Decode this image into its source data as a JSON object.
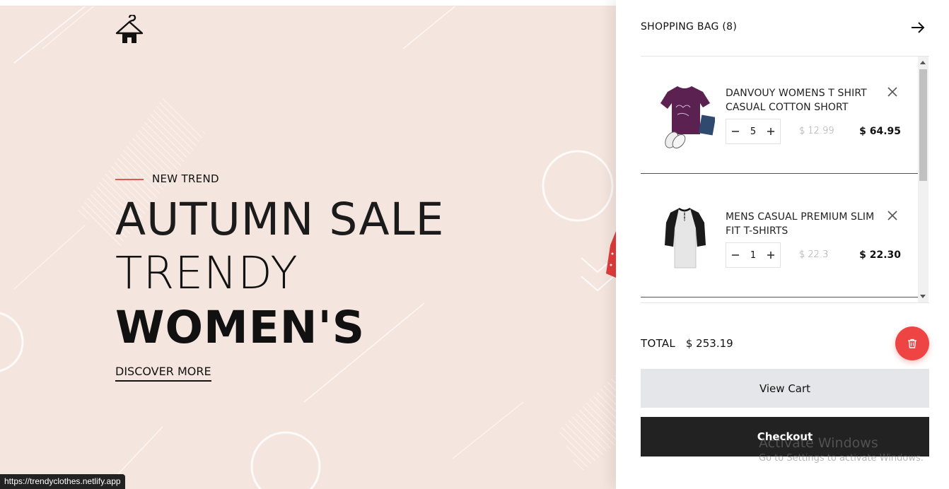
{
  "hero": {
    "eyebrow": "NEW TREND",
    "headline_line1": "AUTUMN SALE",
    "headline_line2": "TRENDY",
    "headline_line3": "WOMEN'S",
    "cta": "DISCOVER MORE",
    "logo_icon": "hanger-icon",
    "background_color": "#f5e5df",
    "accent_color": "#e25656"
  },
  "status_bar": {
    "url": "https://trendyclothes.netlify.app"
  },
  "cart": {
    "title": "SHOPPING BAG (8)",
    "close_icon": "arrow-right-icon",
    "items": [
      {
        "name": "DANVOUY WOMENS T SHIRT CASUAL COTTON SHORT",
        "quantity": "5",
        "unit_price": "$ 12.99",
        "line_total": "$ 64.95",
        "thumb_icon": "purple-tshirt-image"
      },
      {
        "name": "MENS CASUAL PREMIUM SLIM FIT T-SHIRTS",
        "quantity": "1",
        "unit_price": "$ 22.3",
        "line_total": "$ 22.30",
        "thumb_icon": "raglan-tshirt-image"
      }
    ],
    "total_label": "TOTAL",
    "total_value": "$ 253.19",
    "view_cart_label": "View Cart",
    "checkout_label": "Checkout",
    "clear_icon": "trash-icon",
    "danger_color": "#ef4444"
  },
  "os_watermark": {
    "line1": "Activate Windows",
    "line2": "Go to Settings to activate Windows."
  }
}
